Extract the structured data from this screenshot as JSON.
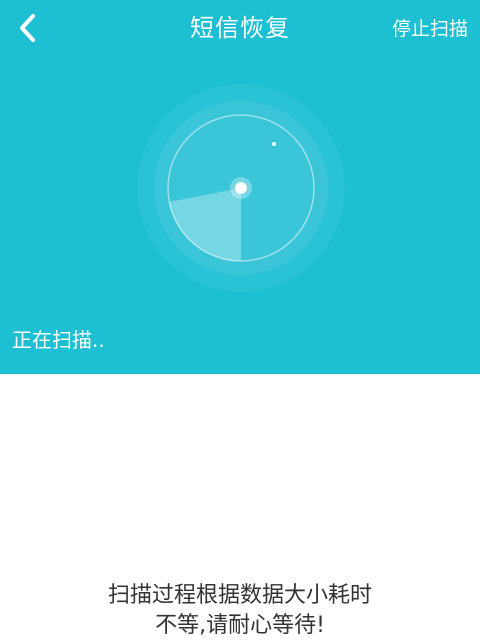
{
  "header": {
    "title": "短信恢复",
    "stop_label": "停止扫描",
    "back_icon": "chevron-left-icon"
  },
  "scanner": {
    "status_text": "正在扫描.."
  },
  "hint": {
    "line1": "扫描过程根据数据大小耗时",
    "line2": "不等,请耐心等待!"
  },
  "colors": {
    "accent": "#1dbfd3",
    "hint_text": "#333333"
  }
}
